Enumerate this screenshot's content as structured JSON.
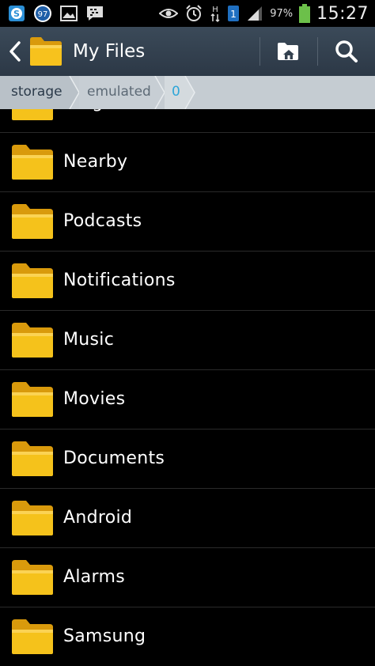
{
  "status_bar": {
    "notification_icons": [
      "skype-icon",
      "badge-97-icon",
      "image-icon",
      "bbm-icon"
    ],
    "badge_count": "97",
    "battery_percent": "97%",
    "time": "15:27",
    "network_label": "H",
    "sim_label": "1"
  },
  "action_bar": {
    "title": "My Files",
    "actions": [
      "home-folder-icon",
      "search-icon"
    ]
  },
  "breadcrumb": {
    "items": [
      "storage",
      "emulated",
      "0"
    ]
  },
  "folders": [
    {
      "name": "Ringtones"
    },
    {
      "name": "Nearby"
    },
    {
      "name": "Podcasts"
    },
    {
      "name": "Notifications"
    },
    {
      "name": "Music"
    },
    {
      "name": "Movies"
    },
    {
      "name": "Documents"
    },
    {
      "name": "Android"
    },
    {
      "name": "Alarms"
    },
    {
      "name": "Samsung"
    }
  ],
  "colors": {
    "action_bar": "#34414f",
    "breadcrumb_bg": "#c5ccd2",
    "breadcrumb_active": "#2ea6d8",
    "folder_yellow": "#f5c21b",
    "background": "#000000"
  }
}
